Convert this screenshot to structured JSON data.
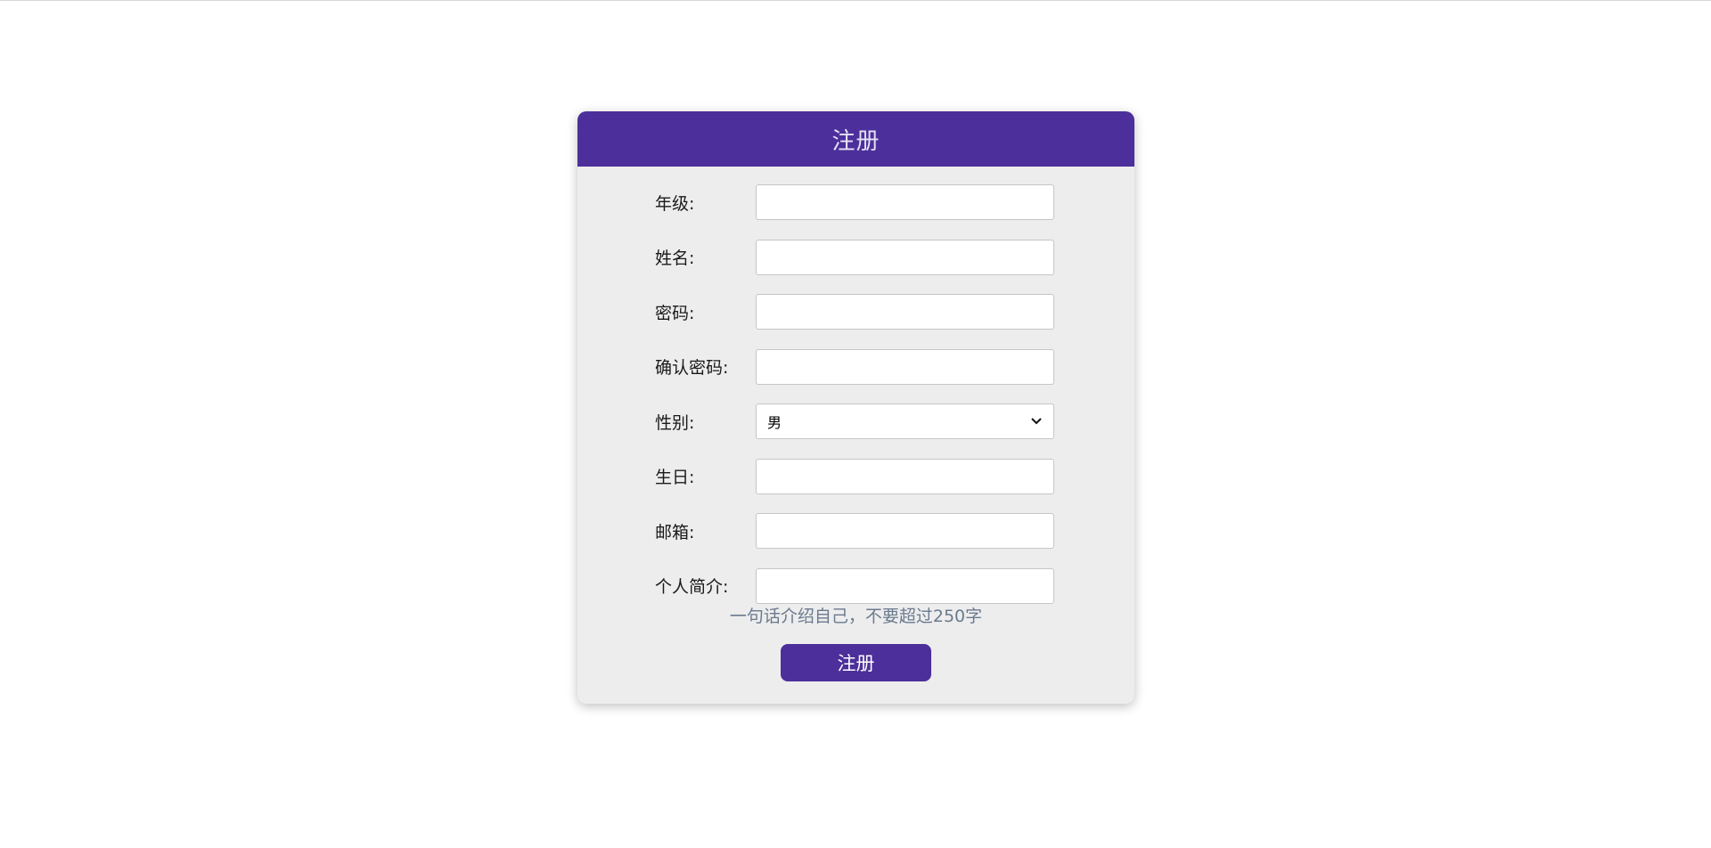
{
  "form": {
    "title": "注册",
    "fields": [
      {
        "label": "年级:",
        "value": ""
      },
      {
        "label": "姓名:",
        "value": ""
      },
      {
        "label": "密码:",
        "value": ""
      },
      {
        "label": "确认密码:",
        "value": ""
      },
      {
        "label": "性别:",
        "value": "男"
      },
      {
        "label": "生日:",
        "value": ""
      },
      {
        "label": "邮箱:",
        "value": ""
      },
      {
        "label": "个人简介:",
        "value": ""
      }
    ],
    "hint": "一句话介绍自己，不要超过250字",
    "submit_label": "注册"
  },
  "colors": {
    "accent": "#4c2f9a",
    "card_bg": "#ededed",
    "hint": "#6b7a8f"
  }
}
